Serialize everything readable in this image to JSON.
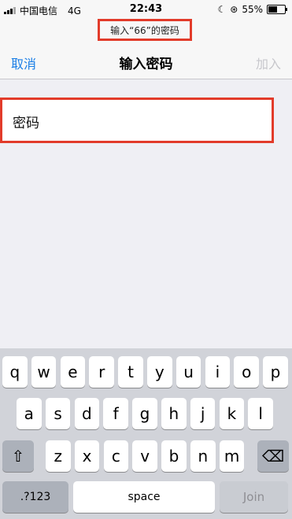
{
  "status_bar": {
    "carrier": "中国电信",
    "network": "4G",
    "time": "22:43",
    "battery": "55%",
    "battery_level": 0.55
  },
  "prompt": {
    "text": "输入“66”的密码"
  },
  "nav": {
    "cancel": "取消",
    "title": "输入密码",
    "join": "加入"
  },
  "password_field": {
    "label": "密码",
    "value": ""
  },
  "keyboard": {
    "row1": [
      "q",
      "w",
      "e",
      "r",
      "t",
      "y",
      "u",
      "i",
      "o",
      "p"
    ],
    "row2": [
      "a",
      "s",
      "d",
      "f",
      "g",
      "h",
      "j",
      "k",
      "l"
    ],
    "row3": [
      "z",
      "x",
      "c",
      "v",
      "b",
      "n",
      "m"
    ],
    "numbers": ".?123",
    "space": "space",
    "join": "Join"
  },
  "colors": {
    "highlight": "#e23b2a",
    "link": "#1a7ee6",
    "disabled": "#c7c7cc"
  }
}
